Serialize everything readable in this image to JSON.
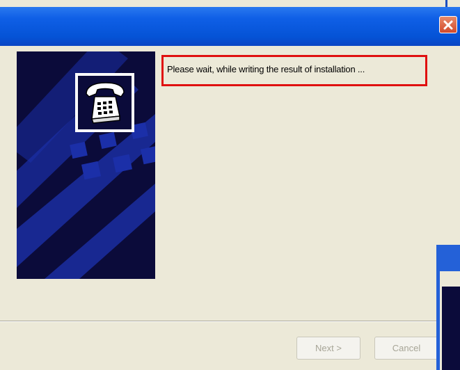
{
  "dialog": {
    "title": "",
    "message": "Please wait, while writing the result of installation ...",
    "buttons": {
      "next_label": "Next >",
      "cancel_label": "Cancel"
    }
  },
  "icons": {
    "close": "close-icon",
    "telephone": "telephone-icon"
  },
  "colors": {
    "titlebar": "#0553d6",
    "highlight_box": "#e01010",
    "side_panel": "#0b0b3a",
    "side_pattern": "#1b2fa8",
    "dialog_background": "#ece9d8"
  }
}
